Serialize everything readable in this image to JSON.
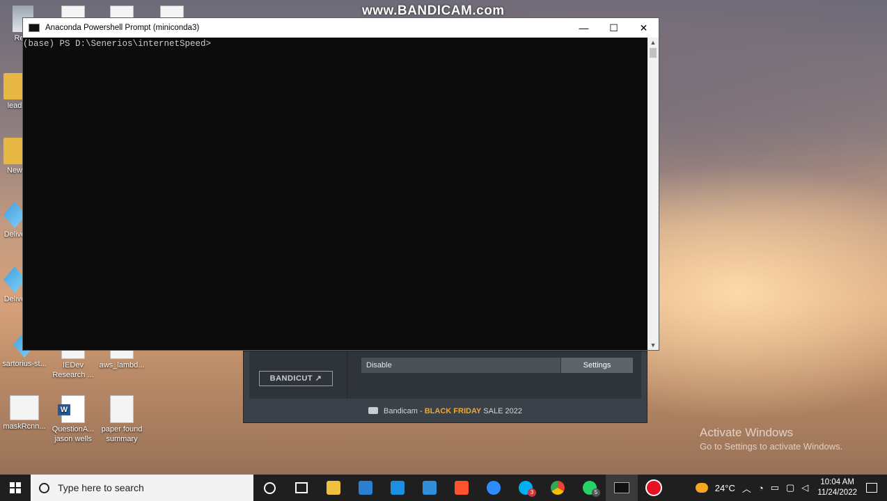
{
  "watermark": "www.BANDICAM.com",
  "desktop": {
    "icons": [
      {
        "label": "Recy"
      },
      {
        "label": "lead"
      },
      {
        "label": "New"
      },
      {
        "label": "Delive"
      },
      {
        "label": "Delive"
      },
      {
        "label": "sartorius-st..."
      },
      {
        "label": "IEDev Research ..."
      },
      {
        "label": "aws_lambd..."
      },
      {
        "label": "maskRcnn..."
      },
      {
        "label": "QuestionA... jason wells"
      },
      {
        "label": "paper found summary"
      }
    ]
  },
  "window": {
    "title": "Anaconda Powershell Prompt (miniconda3)",
    "controls": {
      "minimize": "—",
      "maximize": "☐",
      "close": "✕"
    },
    "prompt": "(base) PS D:\\Senerios\\internetSpeed>"
  },
  "bandicam": {
    "bandicut_label": "BANDICUT ↗",
    "disable_label": "Disable",
    "settings_label": "Settings",
    "promo_prefix": "Bandicam - ",
    "promo_highlight": "BLACK FRIDAY",
    "promo_suffix": " SALE 2022",
    "colors": {
      "highlight": "#f5a623"
    }
  },
  "activation": {
    "line1": "Activate Windows",
    "line2": "Go to Settings to activate Windows."
  },
  "taskbar": {
    "search_placeholder": "Type here to search",
    "apps": [
      {
        "icon": "cortana-icon"
      },
      {
        "icon": "task-view-icon"
      },
      {
        "icon": "file-explorer-icon"
      },
      {
        "icon": "microsoft-store-icon"
      },
      {
        "icon": "mail-icon"
      },
      {
        "icon": "vscode-icon"
      },
      {
        "icon": "brave-icon"
      },
      {
        "icon": "zoom-icon"
      },
      {
        "icon": "skype-icon",
        "badge": "3"
      },
      {
        "icon": "chrome-icon"
      },
      {
        "icon": "whatsapp-icon",
        "badge": "5"
      },
      {
        "icon": "terminal-icon"
      },
      {
        "icon": "bandicam-record-icon"
      }
    ],
    "weather": "24°C",
    "time": "10:04 AM",
    "date": "11/24/2022"
  }
}
